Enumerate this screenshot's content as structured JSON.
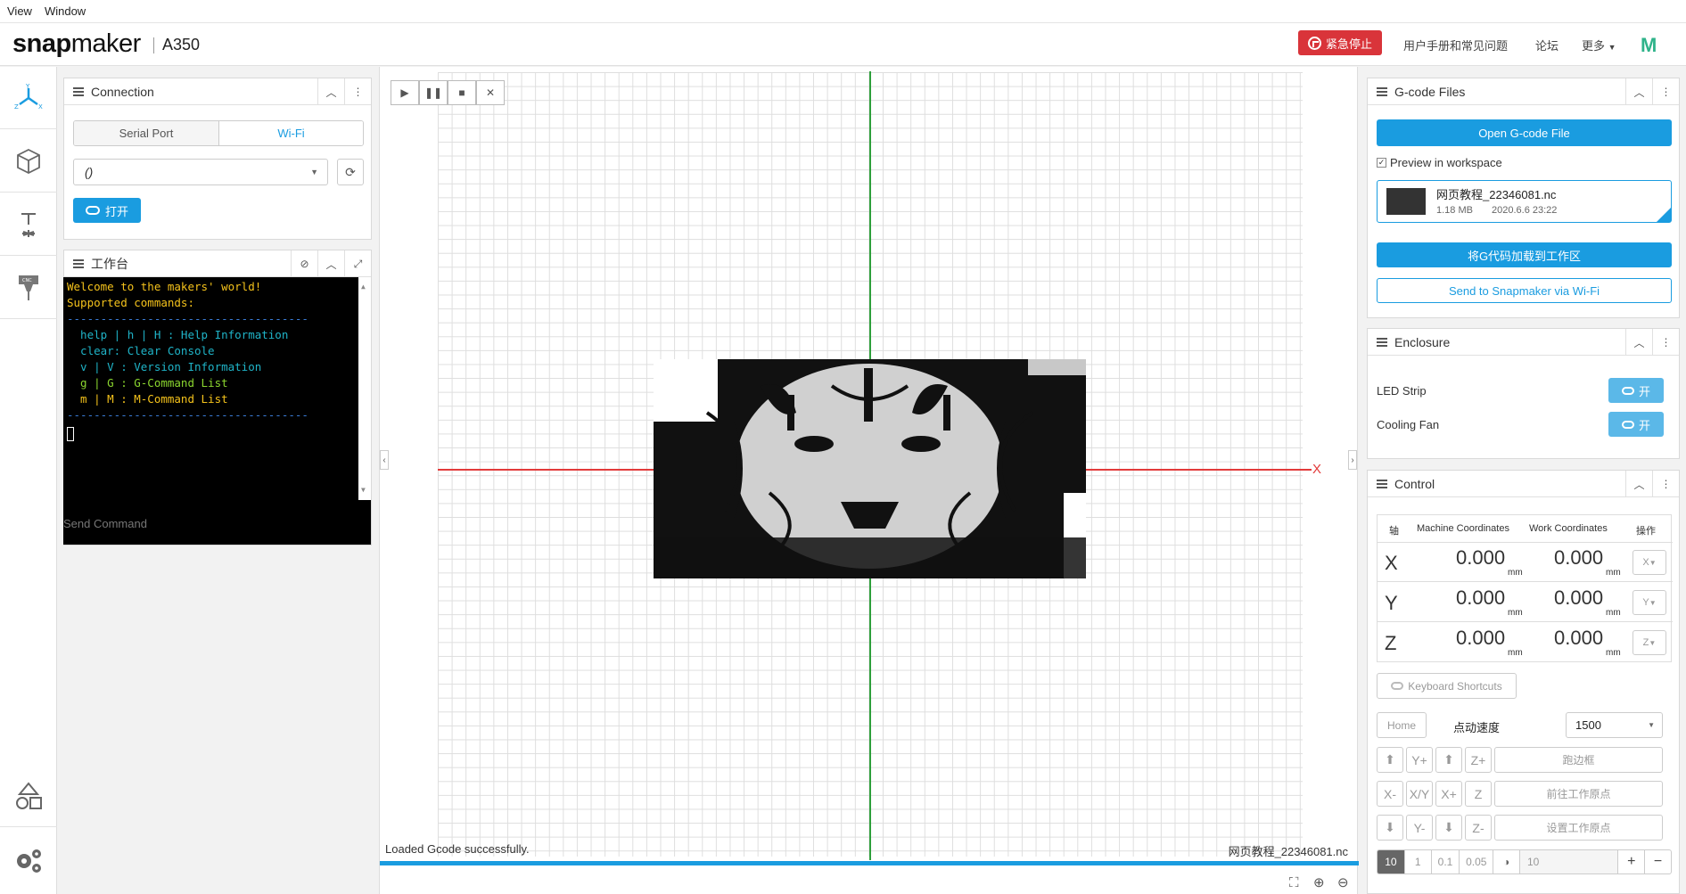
{
  "menubar": {
    "items": [
      "View",
      "Window"
    ]
  },
  "header": {
    "logo_snap": "snap",
    "logo_maker": "maker",
    "model": "A350",
    "estop_label": "紧急停止",
    "manual_link": "用户手册和常见问题",
    "forum_link": "论坛",
    "more_link": "更多",
    "brand_badge": "M"
  },
  "sidebar": {
    "items": [
      "workspace-icon",
      "3dp-icon",
      "laser-icon",
      "cnc-icon",
      "models-icon",
      "settings-icon"
    ]
  },
  "connection": {
    "title": "Connection",
    "tabs": [
      "Serial Port",
      "Wi-Fi"
    ],
    "active_tab": "Wi-Fi",
    "select_value": "()",
    "open_button": "打开"
  },
  "console": {
    "title": "工作台",
    "lines": [
      {
        "text": "Welcome to the makers' world!",
        "color": "yellow"
      },
      {
        "text": "Supported commands:",
        "color": "yellow"
      },
      {
        "text": "------------------------------------",
        "color": "dash"
      },
      {
        "text": "  help | h | H : Help Information",
        "color": "cyan"
      },
      {
        "text": "  clear: Clear Console",
        "color": "cyan"
      },
      {
        "text": "  v | V : Version Information",
        "color": "cyan"
      },
      {
        "text": "  g | G : G-Command List",
        "color": "green"
      },
      {
        "text": "  m | M : M-Command List",
        "color": "yellow"
      },
      {
        "text": "------------------------------------",
        "color": "dash"
      }
    ],
    "send_placeholder": "Send Command"
  },
  "viewport": {
    "status": "Loaded Gcode successfully.",
    "filename": "网页教程_22346081.nc",
    "axis_x_label": "X"
  },
  "gcode_files": {
    "title": "G-code Files",
    "open_button": "Open G-code File",
    "preview_label": "Preview in workspace",
    "preview_checked": true,
    "file_name": "网页教程_22346081.nc",
    "file_size": "1.18 MB",
    "file_date": "2020.6.6 23:22",
    "load_button": "将G代码加载到工作区",
    "send_wifi_button": "Send to Snapmaker via Wi-Fi"
  },
  "enclosure": {
    "title": "Enclosure",
    "led_label": "LED Strip",
    "fan_label": "Cooling Fan",
    "toggle_text": "开"
  },
  "control": {
    "title": "Control",
    "col_axis": "轴",
    "col_machine": "Machine Coordinates",
    "col_work": "Work Coordinates",
    "col_action": "操作",
    "rows": [
      {
        "axis": "X",
        "machine": "0.000",
        "work": "0.000",
        "unit": "mm",
        "action": "X"
      },
      {
        "axis": "Y",
        "machine": "0.000",
        "work": "0.000",
        "unit": "mm",
        "action": "Y"
      },
      {
        "axis": "Z",
        "machine": "0.000",
        "work": "0.000",
        "unit": "mm",
        "action": "Z"
      }
    ],
    "shortcuts_label": "Keyboard Shortcuts",
    "home_label": "Home",
    "jog_speed_label": "点动速度",
    "jog_speed_value": "1500",
    "jog_buttons": {
      "y_plus": "Y+",
      "z_plus": "Z+",
      "run_boundary": "跑边框",
      "x_minus": "X-",
      "xy": "X/Y",
      "x_plus": "X+",
      "z": "Z",
      "goto_origin": "前往工作原点",
      "y_minus": "Y-",
      "z_minus": "Z-",
      "set_origin": "设置工作原点"
    },
    "steps": [
      "10",
      "1",
      "0.1",
      "0.05"
    ],
    "step_active": "10",
    "custom_step": "10"
  }
}
